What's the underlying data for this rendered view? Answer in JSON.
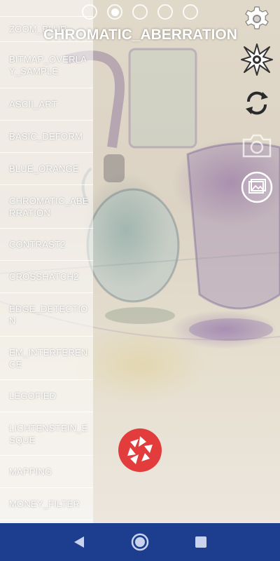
{
  "effects": {
    "list": [
      "ZOOM_BLUR",
      "BITMAP_OVERLAY_SAMPLE",
      "ASCII_ART",
      "BASIC_DEFORM",
      "BLUE_ORANGE",
      "CHROMATIC_ABERRATION",
      "CONTRAST2",
      "CROSSHATCH2",
      "EDGE_DETECTION",
      "EM_INTERFERENCE",
      "LEGOFIED",
      "LICHTENSTEIN_ESQUE",
      "MAPPING",
      "MONEY_FILTER"
    ],
    "current": "CHROMATIC_ABERRATION"
  },
  "pager": {
    "count": 5,
    "active_index": 1
  },
  "tools": {
    "icons": [
      "gear-icon",
      "sparkle-effect-icon",
      "switch-camera-icon",
      "camera-icon",
      "gallery-icon"
    ]
  },
  "nav": {
    "icons": [
      "back-triangle-icon",
      "home-circle-icon",
      "recents-square-icon"
    ]
  },
  "colors": {
    "shutter": "#e23c3c",
    "navbar": "#1d3e8f",
    "list_overlay": "rgba(255,255,255,0.55)"
  }
}
